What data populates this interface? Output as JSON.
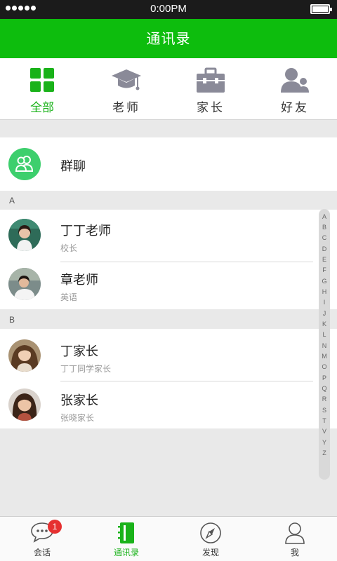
{
  "status_bar": {
    "time": "0:00PM"
  },
  "nav": {
    "title": "通讯录"
  },
  "categories": [
    {
      "label": "全部",
      "icon": "grid-icon",
      "active": true
    },
    {
      "label": "老师",
      "icon": "graduation-cap-icon",
      "active": false
    },
    {
      "label": "家长",
      "icon": "briefcase-icon",
      "active": false
    },
    {
      "label": "好友",
      "icon": "friends-icon",
      "active": false
    }
  ],
  "group_chat": {
    "label": "群聊",
    "icon": "group-icon"
  },
  "sections": [
    {
      "letter": "A",
      "contacts": [
        {
          "name": "丁丁老师",
          "subtitle": "校长",
          "avatar": "teacher-avatar"
        },
        {
          "name": "章老师",
          "subtitle": "英语",
          "avatar": "teacher-avatar"
        }
      ]
    },
    {
      "letter": "B",
      "contacts": [
        {
          "name": "丁家长",
          "subtitle": "丁丁同学家长",
          "avatar": "parent-avatar"
        },
        {
          "name": "张家长",
          "subtitle": "张晓家长",
          "avatar": "parent-avatar"
        }
      ]
    }
  ],
  "index_letters": [
    "A",
    "B",
    "C",
    "D",
    "E",
    "F",
    "G",
    "H",
    "I",
    "J",
    "K",
    "L",
    "N",
    "M",
    "O",
    "P",
    "Q",
    "R",
    "S",
    "T",
    "V",
    "Y",
    "Z"
  ],
  "tabs": [
    {
      "label": "会话",
      "icon": "chat-bubble-icon",
      "badge": "1",
      "active": false
    },
    {
      "label": "通讯录",
      "icon": "address-book-icon",
      "active": true
    },
    {
      "label": "发现",
      "icon": "compass-icon",
      "active": false
    },
    {
      "label": "我",
      "icon": "user-icon",
      "active": false
    }
  ],
  "colors": {
    "brand_green": "#0dbd0d",
    "active_green": "#19b219",
    "group_icon_green": "#3dcf6d",
    "badge_red": "#e63030",
    "icon_gray": "#8a8a98"
  }
}
